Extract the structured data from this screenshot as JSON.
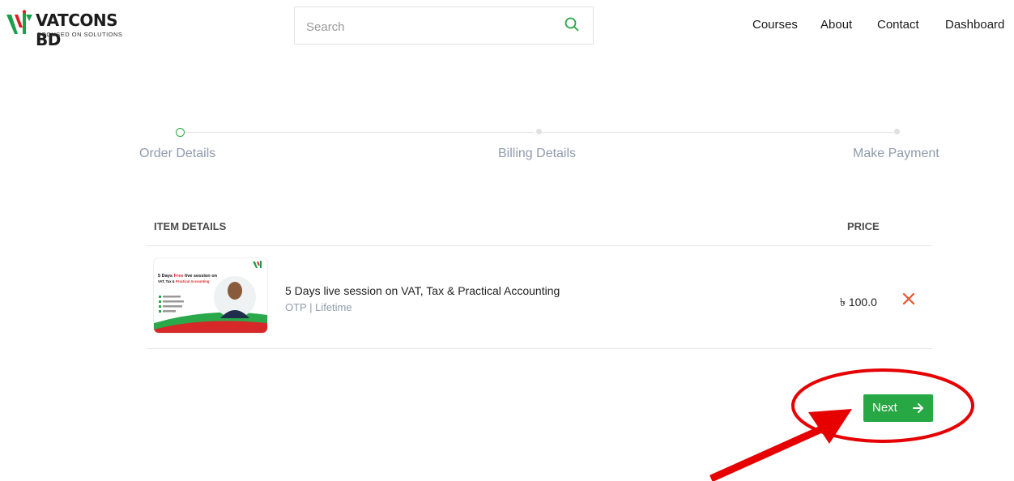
{
  "header": {
    "brand": "VATCONS BD",
    "tagline": "FOCUSED ON SOLUTIONS",
    "search_placeholder": "Search",
    "nav": [
      "Courses",
      "About",
      "Contact",
      "Dashboard"
    ]
  },
  "stepper": {
    "steps": [
      "Order Details",
      "Billing Details",
      "Make Payment"
    ],
    "active_index": 0
  },
  "cart": {
    "col_item": "ITEM DETAILS",
    "col_price": "PRICE",
    "items": [
      {
        "thumb_title_1": "5 Days",
        "thumb_title_free": "Free",
        "thumb_title_2": "live session on",
        "thumb_title_3": "VAT, Tax &",
        "thumb_title_pa": "Practical Accounting",
        "title": "5 Days live session on VAT, Tax & Practical Accounting",
        "meta": "OTP | Lifetime",
        "price": "৳ 100.0"
      }
    ]
  },
  "actions": {
    "next_label": "Next"
  },
  "colors": {
    "accent": "#28a745",
    "remove": "#e4572e",
    "annotation": "#e60000"
  }
}
